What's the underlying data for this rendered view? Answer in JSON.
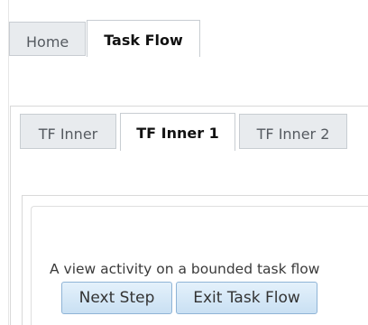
{
  "outer_tabs": [
    {
      "label": "Home",
      "selected": false
    },
    {
      "label": "Task Flow",
      "selected": true
    }
  ],
  "inner_tabs": [
    {
      "label": "TF Inner",
      "selected": false
    },
    {
      "label": "TF Inner 1",
      "selected": true
    },
    {
      "label": "TF Inner 2",
      "selected": false
    }
  ],
  "content": {
    "description": "A view activity on a bounded task flow",
    "next_button_label": "Next Step",
    "exit_button_label": "Exit Task Flow"
  },
  "colors": {
    "tab_inactive_bg": "#e8ebee",
    "tab_border": "#c8cdd2",
    "button_bg": "#c9e0f3",
    "button_border": "#8fb4d6"
  }
}
